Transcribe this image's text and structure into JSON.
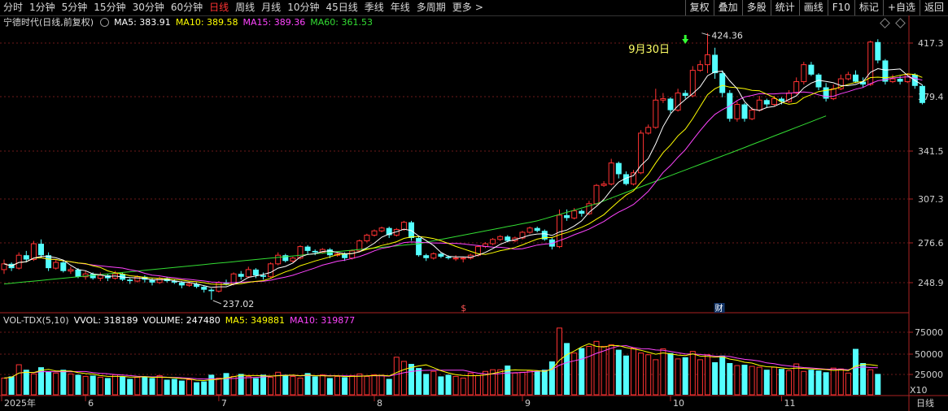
{
  "toolbar": {
    "periods": [
      "分时",
      "1分钟",
      "5分钟",
      "15分钟",
      "30分钟",
      "60分钟",
      "日线",
      "周线",
      "月线",
      "10分钟",
      "45日线",
      "季线",
      "年线",
      "多周期",
      "更多"
    ],
    "active_period": "日线",
    "more_arrow": ">",
    "right_buttons": [
      "复权",
      "叠加",
      "多股",
      "统计",
      "画线",
      "F10",
      "标记",
      "+自选",
      "返回"
    ]
  },
  "price_legend": {
    "title": "宁德时代(日线,前复权)",
    "items": [
      {
        "label": "MA5: 383.91",
        "color": "#ffffff"
      },
      {
        "label": "MA10: 389.58",
        "color": "#ffff00"
      },
      {
        "label": "MA15: 389.36",
        "color": "#ff44ff"
      },
      {
        "label": "MA60: 361.53",
        "color": "#33dd33"
      }
    ]
  },
  "price_axis_labels": [
    "417.3",
    "379.4",
    "341.5",
    "307.3",
    "276.6",
    "248.9"
  ],
  "annotations": {
    "high_label": "424.36",
    "low_label": "237.02",
    "date_label": "9月30日",
    "event_marks": [
      "$",
      "财"
    ]
  },
  "volume_legend": {
    "title": "VOL-TDX(5,10)",
    "items": [
      {
        "label": "VVOL: 318189",
        "color": "#ffffff"
      },
      {
        "label": "VOLUME: 247480",
        "color": "#ffffff"
      },
      {
        "label": "MA5: 349881",
        "color": "#ffff00"
      },
      {
        "label": "MA10: 319877",
        "color": "#ff44ff"
      }
    ]
  },
  "volume_axis_labels": [
    "75000",
    "50000",
    "25000"
  ],
  "volume_unit": "X10",
  "x_axis_labels": [
    "2025年",
    "6",
    "7",
    "8",
    "9",
    "10",
    "11"
  ],
  "period_badge": "日线",
  "colors": {
    "up": "#ff3232",
    "down": "#54ffff",
    "ma5": "#ffffff",
    "ma10": "#ffff00",
    "ma15": "#ff44ff",
    "ma60": "#33dd33",
    "axis": "#aa2222",
    "grid": "#6e1a1a"
  },
  "chart_data": [
    {
      "type": "candlestick",
      "title": "宁德时代(日线,前复权)",
      "y_ticks": [
        417.3,
        379.4,
        341.5,
        307.3,
        276.6,
        248.9
      ],
      "ylim": [
        238,
        425
      ],
      "high": 424.36,
      "low": 237.02,
      "x_month_labels": [
        "2025年",
        "6",
        "7",
        "8",
        "9",
        "10",
        "11"
      ],
      "candles": [
        [
          258,
          262,
          255,
          265
        ],
        [
          262,
          259,
          257,
          263
        ],
        [
          259,
          268,
          258,
          270
        ],
        [
          268,
          265,
          263,
          271
        ],
        [
          265,
          276,
          264,
          278
        ],
        [
          276,
          268,
          266,
          279
        ],
        [
          268,
          259,
          257,
          270
        ],
        [
          259,
          263,
          258,
          265
        ],
        [
          263,
          257,
          256,
          264
        ],
        [
          257,
          258,
          255,
          260
        ],
        [
          258,
          253,
          252,
          259
        ],
        [
          253,
          255,
          251,
          257
        ],
        [
          255,
          252,
          251,
          256
        ],
        [
          252,
          254,
          250,
          256
        ],
        [
          254,
          252,
          250,
          255
        ],
        [
          252,
          255,
          251,
          257
        ],
        [
          255,
          251,
          250,
          256
        ],
        [
          251,
          250,
          248,
          252
        ],
        [
          250,
          253,
          249,
          254
        ],
        [
          253,
          251,
          249,
          254
        ],
        [
          251,
          249,
          247,
          252
        ],
        [
          249,
          252,
          248,
          253
        ],
        [
          252,
          250,
          249,
          253
        ],
        [
          250,
          249,
          248,
          251
        ],
        [
          249,
          247,
          245,
          250
        ],
        [
          247,
          248,
          246,
          249
        ],
        [
          248,
          246,
          245,
          249
        ],
        [
          246,
          244,
          242,
          247
        ],
        [
          244,
          243,
          237,
          245
        ],
        [
          243,
          249,
          242,
          250
        ],
        [
          249,
          248,
          247,
          251
        ],
        [
          248,
          255,
          247,
          256
        ],
        [
          255,
          253,
          251,
          257
        ],
        [
          253,
          258,
          252,
          260
        ],
        [
          258,
          254,
          252,
          259
        ],
        [
          254,
          253,
          251,
          256
        ],
        [
          253,
          262,
          252,
          263
        ],
        [
          262,
          268,
          261,
          270
        ],
        [
          268,
          264,
          263,
          269
        ],
        [
          264,
          266,
          263,
          267
        ],
        [
          266,
          274,
          265,
          275
        ],
        [
          274,
          271,
          269,
          275
        ],
        [
          271,
          270,
          268,
          272
        ],
        [
          270,
          272,
          269,
          273
        ],
        [
          272,
          268,
          266,
          273
        ],
        [
          268,
          269,
          267,
          270
        ],
        [
          269,
          266,
          264,
          270
        ],
        [
          266,
          271,
          265,
          272
        ],
        [
          271,
          278,
          270,
          279
        ],
        [
          278,
          282,
          277,
          283
        ],
        [
          282,
          285,
          281,
          286
        ],
        [
          285,
          287,
          284,
          288
        ],
        [
          287,
          282,
          280,
          288
        ],
        [
          282,
          286,
          281,
          287
        ],
        [
          286,
          291,
          285,
          292
        ],
        [
          291,
          280,
          278,
          292
        ],
        [
          280,
          268,
          267,
          281
        ],
        [
          268,
          266,
          264,
          269
        ],
        [
          266,
          269,
          265,
          270
        ],
        [
          269,
          267,
          266,
          270
        ],
        [
          267,
          266,
          265,
          268
        ],
        [
          266,
          266,
          264,
          268
        ],
        [
          266,
          266,
          263,
          267
        ],
        [
          266,
          268,
          265,
          269
        ],
        [
          268,
          274,
          267,
          275
        ],
        [
          274,
          276,
          273,
          277
        ],
        [
          276,
          279,
          275,
          280
        ],
        [
          279,
          281,
          278,
          282
        ],
        [
          281,
          278,
          277,
          282
        ],
        [
          278,
          280,
          277,
          281
        ],
        [
          280,
          284,
          279,
          285
        ],
        [
          284,
          287,
          283,
          288
        ],
        [
          287,
          285,
          284,
          288
        ],
        [
          285,
          279,
          278,
          286
        ],
        [
          279,
          274,
          272,
          280
        ],
        [
          274,
          296,
          273,
          300
        ],
        [
          296,
          294,
          292,
          300
        ],
        [
          294,
          299,
          293,
          301
        ],
        [
          299,
          297,
          295,
          300
        ],
        [
          297,
          304,
          296,
          306
        ],
        [
          304,
          317,
          303,
          318
        ],
        [
          317,
          318,
          316,
          320
        ],
        [
          318,
          333,
          317,
          336
        ],
        [
          333,
          325,
          322,
          334
        ],
        [
          325,
          318,
          317,
          327
        ],
        [
          318,
          326,
          317,
          328
        ],
        [
          326,
          354,
          325,
          356
        ],
        [
          354,
          358,
          353,
          360
        ],
        [
          358,
          377,
          357,
          385
        ],
        [
          377,
          378,
          375,
          382
        ],
        [
          378,
          370,
          368,
          379
        ],
        [
          370,
          382,
          369,
          385
        ],
        [
          382,
          380,
          378,
          384
        ],
        [
          380,
          398,
          379,
          401
        ],
        [
          398,
          402,
          397,
          405
        ],
        [
          402,
          409,
          396,
          424.36
        ],
        [
          409,
          396,
          392,
          414
        ],
        [
          396,
          382,
          379,
          398
        ],
        [
          382,
          364,
          362,
          384
        ],
        [
          364,
          374,
          362,
          376
        ],
        [
          374,
          364,
          362,
          375
        ],
        [
          364,
          370,
          363,
          372
        ],
        [
          370,
          377,
          369,
          380
        ],
        [
          377,
          374,
          372,
          378
        ],
        [
          374,
          378,
          373,
          380
        ],
        [
          378,
          376,
          374,
          379
        ],
        [
          376,
          382,
          375,
          384
        ],
        [
          382,
          390,
          381,
          393
        ],
        [
          390,
          402,
          388,
          404
        ],
        [
          402,
          395,
          394,
          404
        ],
        [
          395,
          386,
          384,
          396
        ],
        [
          386,
          378,
          376,
          389
        ],
        [
          378,
          385,
          377,
          388
        ],
        [
          385,
          392,
          384,
          395
        ],
        [
          392,
          395,
          391,
          397
        ],
        [
          395,
          390,
          389,
          398
        ],
        [
          390,
          388,
          386,
          393
        ],
        [
          388,
          418,
          387,
          419
        ],
        [
          418,
          405,
          403,
          420
        ],
        [
          405,
          390,
          388,
          406
        ],
        [
          390,
          392,
          389,
          395
        ],
        [
          392,
          390,
          388,
          394
        ],
        [
          390,
          395,
          389,
          396
        ],
        [
          395,
          387,
          385,
          396
        ],
        [
          387,
          375,
          374,
          388
        ]
      ],
      "ma60": [
        248,
        248.5,
        249,
        249.5,
        250,
        250.5,
        251,
        251.5,
        252,
        252.5,
        253,
        253.5,
        254,
        254.5,
        255,
        255.5,
        256,
        256.5,
        257,
        257.5,
        258,
        258.5,
        259,
        259.5,
        260,
        260.5,
        261,
        261.5,
        262,
        262.5,
        263,
        263.5,
        264,
        264.5,
        265,
        265.5,
        266,
        266.5,
        267,
        267.5,
        268,
        268.5,
        269,
        269.5,
        270,
        270.5,
        271,
        271.5,
        272,
        272.5,
        273,
        273.5,
        274,
        274.5,
        275,
        275.5,
        276,
        277,
        278,
        279,
        280,
        281,
        282,
        283,
        284,
        285,
        286,
        287,
        288,
        289,
        290,
        291,
        292,
        293.5,
        295,
        296.5,
        298,
        299.5,
        301,
        302.5,
        304,
        306,
        308,
        310,
        312,
        314,
        316,
        318,
        320,
        322,
        324,
        326,
        328,
        330,
        332,
        334,
        336,
        338,
        340,
        342,
        344,
        346,
        348,
        350,
        352,
        354,
        356,
        358,
        360,
        362,
        364,
        366
      ],
      "series_labels": [
        "MA5: 383.91",
        "MA10: 389.58",
        "MA15: 389.36",
        "MA60: 361.53"
      ]
    },
    {
      "type": "bar",
      "title": "VOL-TDX(5,10)",
      "y_ticks": [
        75000,
        50000,
        25000
      ],
      "unit": "X10",
      "values": [
        20,
        22,
        36,
        30,
        25,
        33,
        28,
        26,
        30,
        25,
        24,
        22,
        23,
        21,
        20,
        24,
        22,
        19,
        21,
        22,
        20,
        23,
        18,
        19,
        17,
        18,
        15,
        16,
        24,
        20,
        26,
        22,
        25,
        22,
        20,
        24,
        21,
        27,
        24,
        22,
        20,
        26,
        22,
        24,
        20,
        22,
        21,
        23,
        25,
        22,
        24,
        23,
        19,
        45,
        40,
        37,
        32,
        25,
        28,
        22,
        24,
        22,
        20,
        26,
        23,
        28,
        30,
        30,
        35,
        26,
        27,
        29,
        28,
        30,
        40,
        80,
        62,
        50,
        56,
        58,
        64,
        58,
        60,
        54,
        47,
        56,
        50,
        48,
        42,
        55,
        50,
        43,
        45,
        52,
        42,
        48,
        39,
        47,
        38,
        35,
        36,
        34,
        33,
        30,
        33,
        31,
        29,
        37,
        28,
        30,
        29,
        27,
        32,
        31,
        26,
        55,
        38,
        30,
        25
      ],
      "series_labels": [
        "VVOL: 318189",
        "VOLUME: 247480",
        "MA5: 349881",
        "MA10: 319877"
      ]
    }
  ]
}
